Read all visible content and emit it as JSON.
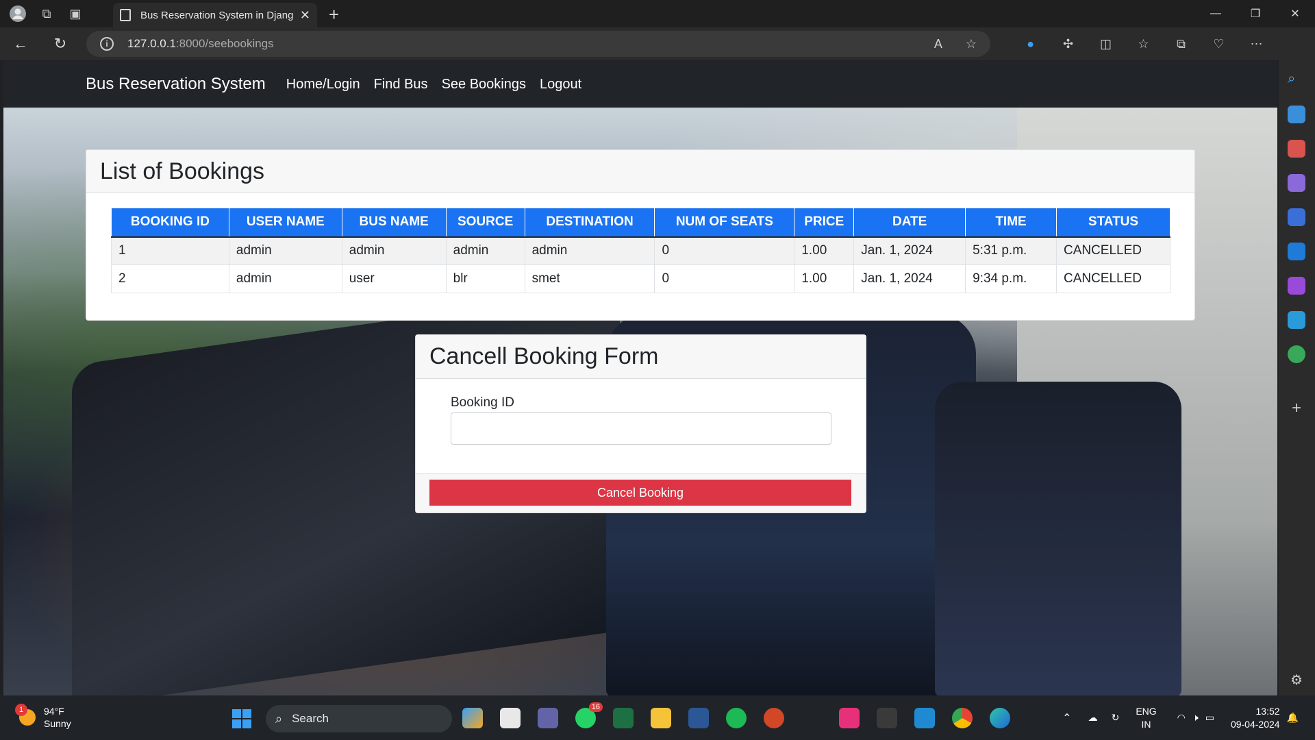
{
  "browser": {
    "tab_title": "Bus Reservation System in Djang",
    "url_host": "127.0.0.1",
    "url_path": ":8000/seebookings"
  },
  "navbar": {
    "brand": "Bus Reservation System",
    "links": [
      "Home/Login",
      "Find Bus",
      "See Bookings",
      "Logout"
    ]
  },
  "bookings": {
    "title": "List of Bookings",
    "columns": [
      "BOOKING ID",
      "USER NAME",
      "BUS NAME",
      "SOURCE",
      "DESTINATION",
      "NUM OF SEATS",
      "PRICE",
      "DATE",
      "TIME",
      "STATUS"
    ],
    "rows": [
      [
        "1",
        "admin",
        "admin",
        "admin",
        "admin",
        "0",
        "1.00",
        "Jan. 1, 2024",
        "5:31 p.m.",
        "CANCELLED"
      ],
      [
        "2",
        "admin",
        "user",
        "blr",
        "smet",
        "0",
        "1.00",
        "Jan. 1, 2024",
        "9:34 p.m.",
        "CANCELLED"
      ]
    ]
  },
  "cancel_form": {
    "title": "Cancell Booking Form",
    "field_label": "Booking ID",
    "field_value": "",
    "button_label": "Cancel Booking"
  },
  "taskbar": {
    "weather_temp": "94°F",
    "weather_desc": "Sunny",
    "weather_badge": "1",
    "search_label": "Search",
    "whatsapp_badge": "16",
    "lang_top": "ENG",
    "lang_bottom": "IN",
    "time": "13:52",
    "date": "09-04-2024"
  },
  "colors": {
    "table_header": "#1a73f2",
    "cancel_button": "#dc3545",
    "navbar": "#212529"
  }
}
